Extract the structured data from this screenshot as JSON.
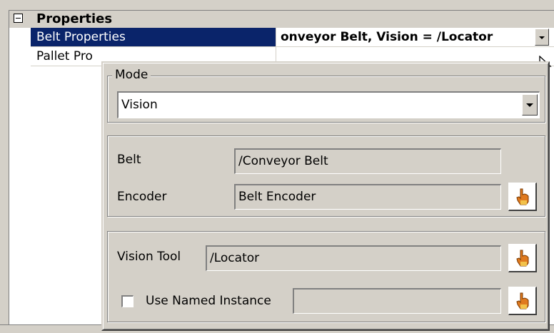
{
  "properties": {
    "category_label": "Properties",
    "rows": [
      {
        "name": "Belt Properties",
        "value": "onveyor Belt, Vision = /Locator"
      },
      {
        "name": "Pallet Pro",
        "value": ""
      }
    ]
  },
  "popup": {
    "mode": {
      "group_title": "Mode",
      "selected": "Vision"
    },
    "belt_group": {
      "belt_label": "Belt",
      "belt_value": "/Conveyor Belt",
      "encoder_label": "Encoder",
      "encoder_value": "Belt Encoder"
    },
    "vision_group": {
      "vision_tool_label": "Vision Tool",
      "vision_tool_value": "/Locator",
      "use_named_instance_label": "Use Named Instance",
      "use_named_instance_checked": false,
      "named_instance_value": ""
    }
  },
  "icons": {
    "expander": "collapse-minus-icon",
    "pick": "pointing-hand-icon",
    "cursor": "mouse-pointer-icon"
  },
  "colors": {
    "selection": "#0a246a",
    "panel": "#d4d0c8",
    "hand": "#e07a1f"
  }
}
